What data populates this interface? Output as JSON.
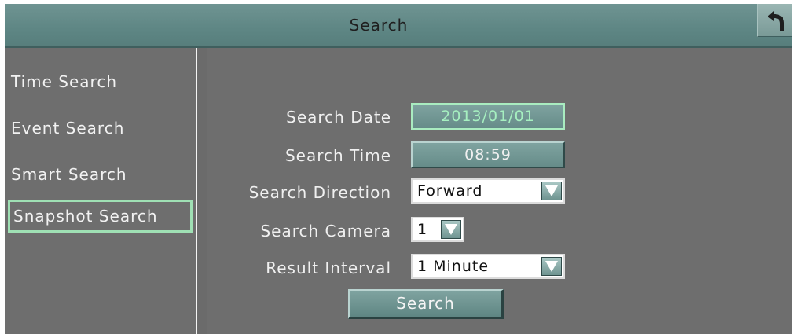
{
  "window": {
    "title": "Search"
  },
  "sidebar": {
    "items": [
      {
        "label": "Time Search"
      },
      {
        "label": "Event Search"
      },
      {
        "label": "Smart Search"
      },
      {
        "label": "Snapshot Search",
        "selected": true
      }
    ]
  },
  "form": {
    "search_date": {
      "label": "Search Date",
      "value": "2013/01/01"
    },
    "search_time": {
      "label": "Search Time",
      "value": "08:59"
    },
    "search_direction": {
      "label": "Search Direction",
      "value": "Forward"
    },
    "search_camera": {
      "label": "Search Camera",
      "value": "1"
    },
    "result_interval": {
      "label": "Result Interval",
      "value": "1 Minute"
    },
    "search_button": {
      "label": "Search"
    }
  },
  "colors": {
    "titlebar": "#5e8684",
    "panel": "#6e6e6e",
    "selection_outline": "#9fe0b4",
    "date_text": "#a6f0c0"
  },
  "icons": {
    "back": "back-arrow-icon",
    "dropdown": "dropdown-arrow-icon"
  }
}
